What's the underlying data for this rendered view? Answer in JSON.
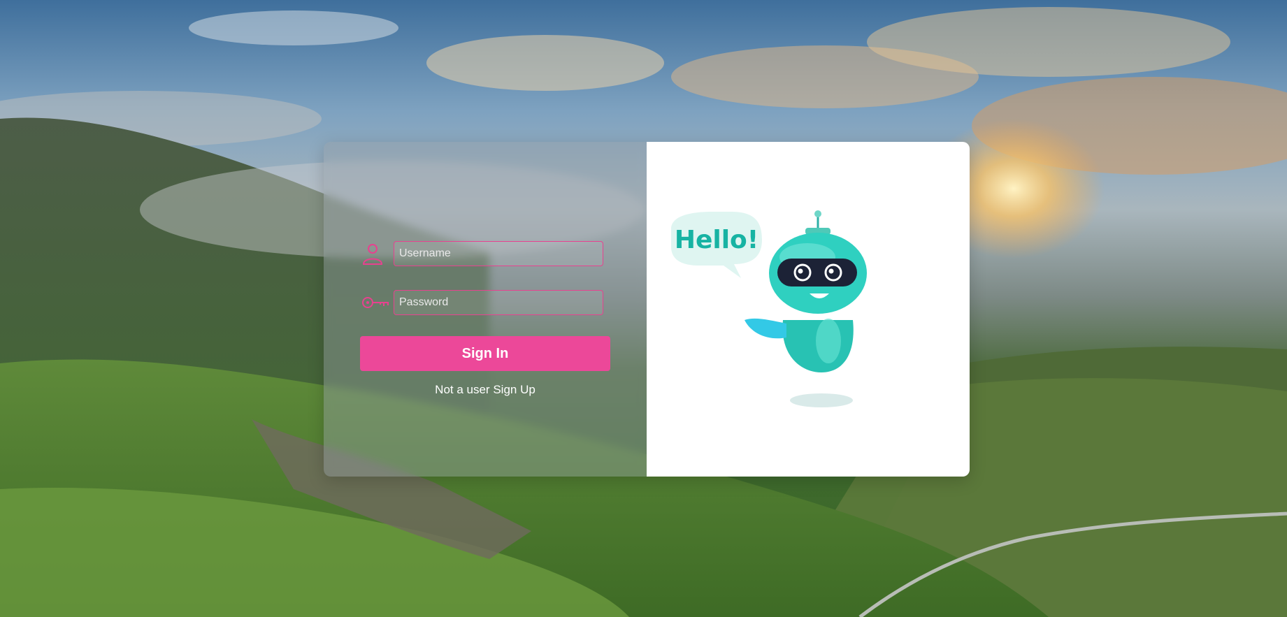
{
  "login": {
    "username_placeholder": "Username",
    "password_placeholder": "Password",
    "signin_label": "Sign In",
    "signup_prompt": "Not a user",
    "signup_link": "Sign Up"
  },
  "illustration": {
    "speech_text": "Hello!"
  },
  "icons": {
    "username": "person-icon",
    "password": "key-icon"
  },
  "colors": {
    "accent": "#ec4899",
    "robot_teal": "#2fd0c0"
  }
}
